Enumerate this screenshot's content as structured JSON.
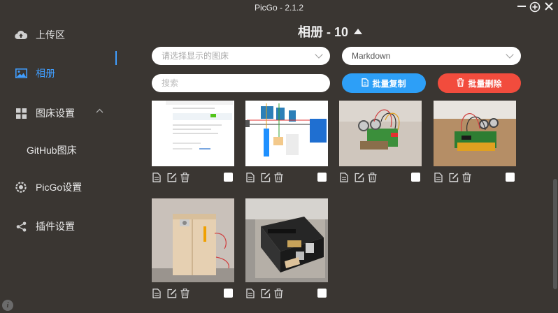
{
  "window": {
    "title": "PicGo - 2.1.2"
  },
  "sidebar": {
    "items": [
      {
        "label": "上传区",
        "icon": "cloud-upload-icon"
      },
      {
        "label": "相册",
        "icon": "image-icon"
      },
      {
        "label": "图床设置",
        "icon": "grid-icon"
      },
      {
        "label": "GitHub图床"
      },
      {
        "label": "PicGo设置",
        "icon": "settings-icon"
      },
      {
        "label": "插件设置",
        "icon": "share-icon"
      }
    ]
  },
  "gallery": {
    "title": "相册 - 10",
    "bed_select_placeholder": "请选择显示的图床",
    "format_select_value": "Markdown",
    "search_placeholder": "搜索",
    "copy_button": "批量复制",
    "delete_button": "批量删除"
  },
  "colors": {
    "accent": "#409eff",
    "blue_button": "#2d9ff7",
    "red_button": "#f24c3d"
  }
}
